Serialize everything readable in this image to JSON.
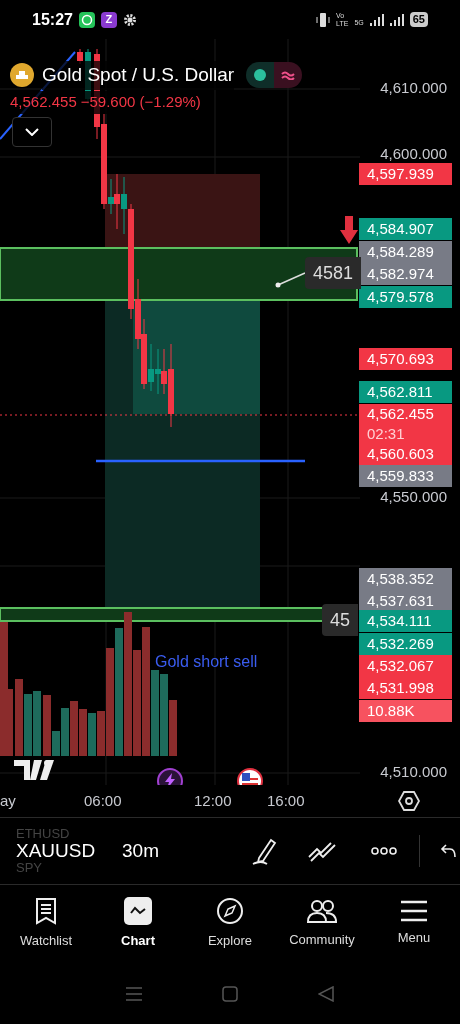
{
  "status_bar": {
    "time": "15:27",
    "app_badge": "Z",
    "network_top": "Vo",
    "network_bottom": "LTE",
    "signal_type": "5G",
    "battery": "65"
  },
  "symbol_header": {
    "title": "Gold Spot / U.S. Dollar",
    "price": "4,562.455",
    "change": "−59.600 (−1.29%)"
  },
  "price_axis": [
    "4,610.000",
    "4,600.000",
    "4,550.000",
    "4,510.000"
  ],
  "price_tags": [
    {
      "text": "4,597.939",
      "color": "#f23645"
    },
    {
      "text": "4,584.907",
      "color": "#089981"
    },
    {
      "text": "4,584.289",
      "color": "#787b86"
    },
    {
      "text": "4,582.974",
      "color": "#787b86"
    },
    {
      "text": "4,579.578",
      "color": "#089981"
    },
    {
      "text": "4,570.693",
      "color": "#f23645"
    },
    {
      "text": "4,562.811",
      "color": "#089981"
    },
    {
      "text": "4,562.455",
      "countdown": "02:31",
      "color": "#f23645"
    },
    {
      "text": "4,560.603",
      "color": "#f23645"
    },
    {
      "text": "4,559.833",
      "color": "#787b86"
    },
    {
      "text": "4,538.352",
      "color": "#787b86"
    },
    {
      "text": "4,537.631",
      "color": "#787b86"
    },
    {
      "text": "4,534.111",
      "color": "#089981"
    },
    {
      "text": "4,532.269",
      "color": "#089981"
    },
    {
      "text": "4,532.067",
      "color": "#f23645"
    },
    {
      "text": "4,531.998",
      "color": "#f23645"
    },
    {
      "text": "10.88K",
      "color": "#f7525f"
    }
  ],
  "floating_labels": [
    "4581",
    "45"
  ],
  "annotation": "Gold short sell",
  "time_axis": [
    "ay",
    "06:00",
    "12:00",
    "16:00"
  ],
  "toolbar": {
    "symbols": [
      {
        "text": "ETHUSD",
        "selected": false
      },
      {
        "text": "XAUUSD",
        "selected": true
      },
      {
        "text": "SPY",
        "selected": false
      }
    ],
    "interval": "30m"
  },
  "nav": [
    {
      "label": "Watchlist",
      "selected": false
    },
    {
      "label": "Chart",
      "selected": true
    },
    {
      "label": "Explore",
      "selected": false
    },
    {
      "label": "Community",
      "selected": false
    },
    {
      "label": "Menu",
      "selected": false
    }
  ]
}
